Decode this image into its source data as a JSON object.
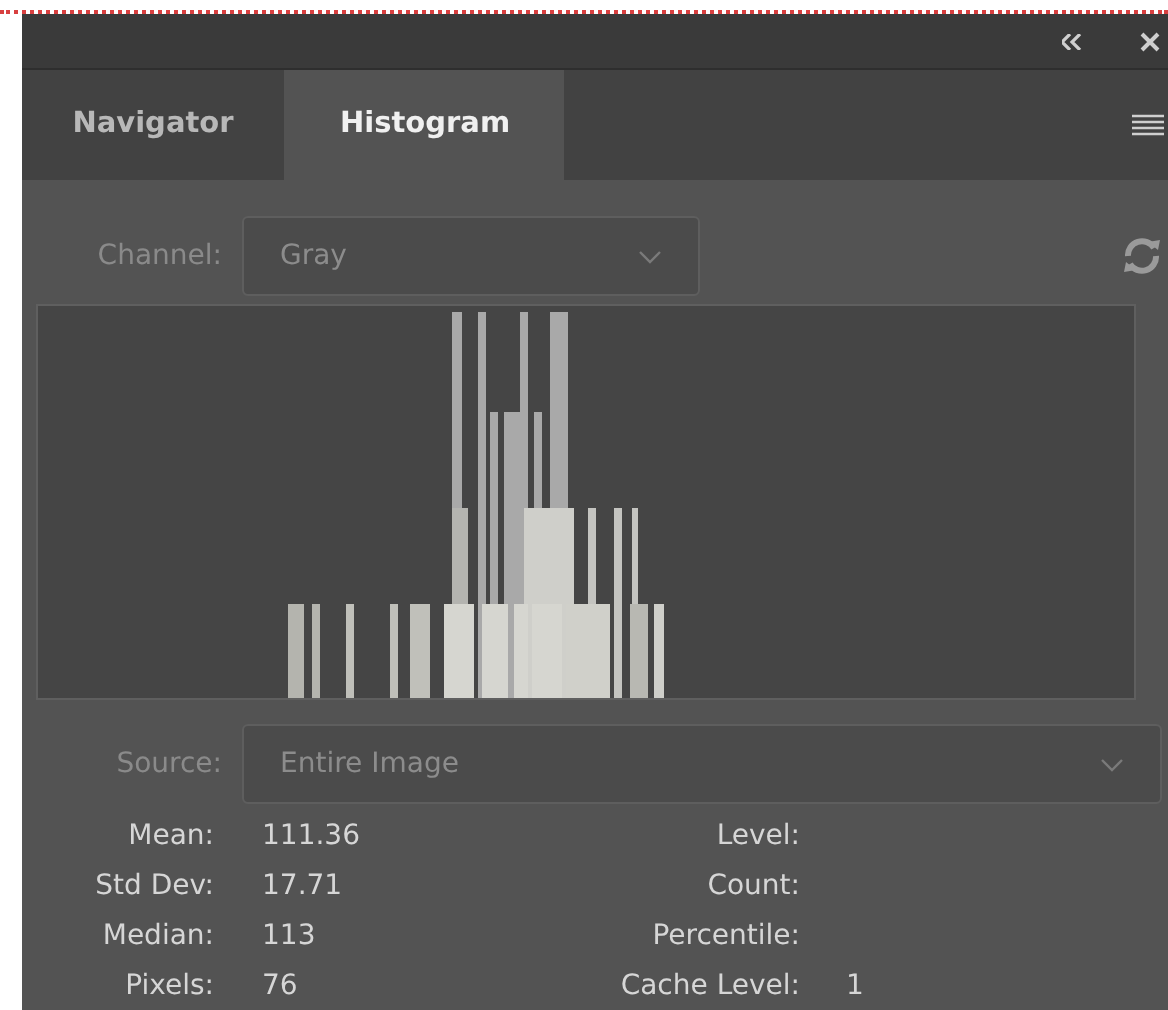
{
  "tabs": [
    {
      "label": "Navigator",
      "selected": false
    },
    {
      "label": "Histogram",
      "selected": true
    }
  ],
  "channel": {
    "label": "Channel:",
    "value": "Gray"
  },
  "source": {
    "label": "Source:",
    "value": "Entire Image"
  },
  "stats_left": [
    {
      "label": "Mean:",
      "value": "111.36"
    },
    {
      "label": "Std Dev:",
      "value": "17.71"
    },
    {
      "label": "Median:",
      "value": "113"
    },
    {
      "label": "Pixels:",
      "value": "76"
    }
  ],
  "stats_right": [
    {
      "label": "Level:"
    },
    {
      "label": "Count:"
    },
    {
      "label": "Percentile:"
    },
    {
      "label": "Cache Level:",
      "value": "1"
    }
  ]
}
